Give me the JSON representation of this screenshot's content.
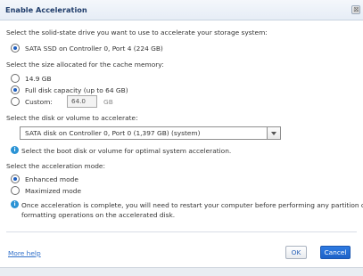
{
  "window": {
    "title": "Enable Acceleration",
    "close_glyph": "⊠"
  },
  "drive": {
    "prompt": "Select the solid-state drive you want to use to accelerate your storage system:",
    "option_label": "SATA SSD on Controller 0, Port 4 (224 GB)"
  },
  "cache": {
    "prompt": "Select the size allocated for the cache memory:",
    "options": [
      {
        "label": "14.9 GB"
      },
      {
        "label": "Full disk capacity (up to 64 GB)"
      },
      {
        "label": "Custom:"
      }
    ],
    "custom_value": "64.0",
    "custom_unit": "GB"
  },
  "volume": {
    "prompt": "Select the disk or volume to accelerate:",
    "selected": "SATA disk on Controller 0, Port 0 (1,397 GB) (system)",
    "hint": "Select the boot disk or volume for optimal system acceleration."
  },
  "mode": {
    "prompt": "Select the acceleration mode:",
    "options": [
      {
        "label": "Enhanced mode"
      },
      {
        "label": "Maximized mode"
      }
    ],
    "note_line1": "Once acceleration is complete, you will need to restart your computer before performing any partition or",
    "note_line2": "formatting operations on the accelerated disk."
  },
  "footer": {
    "help_link": "More help",
    "ok_label": "OK",
    "cancel_label": "Cancel"
  },
  "icons": {
    "info": "i"
  },
  "colors": {
    "accent": "#1f5fbf",
    "info": "#2a93d5",
    "link": "#2f6fc9"
  }
}
